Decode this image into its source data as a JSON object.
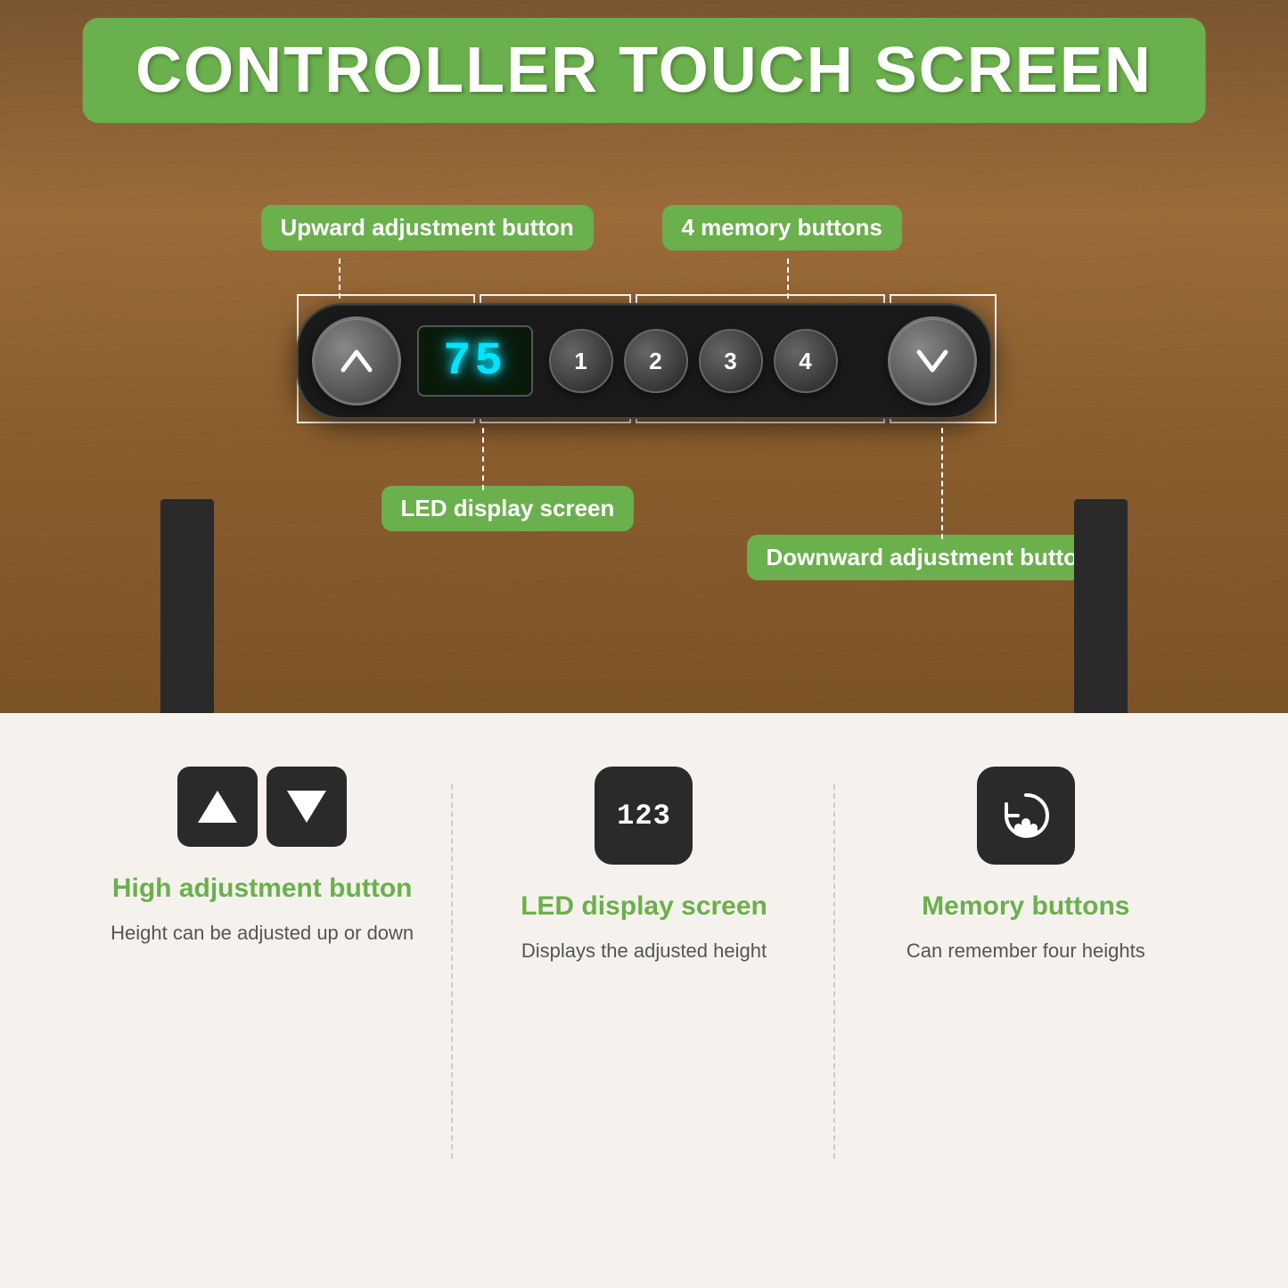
{
  "title": "CONTROLLER TOUCH SCREEN",
  "annotations": {
    "upward_label": "Upward adjustment button",
    "memory_label": "4 memory buttons",
    "led_label": "LED display screen",
    "downward_label": "Downward adjustment button"
  },
  "controller": {
    "led_value": "75",
    "memory_buttons": [
      "1",
      "2",
      "3",
      "4"
    ]
  },
  "features": [
    {
      "id": "adjustment",
      "title": "High adjustment button",
      "description": "Height can be adjusted up or down"
    },
    {
      "id": "led",
      "title": "LED display screen",
      "description": "Displays the adjusted height"
    },
    {
      "id": "memory",
      "title": "Memory buttons",
      "description": "Can remember four heights"
    }
  ]
}
